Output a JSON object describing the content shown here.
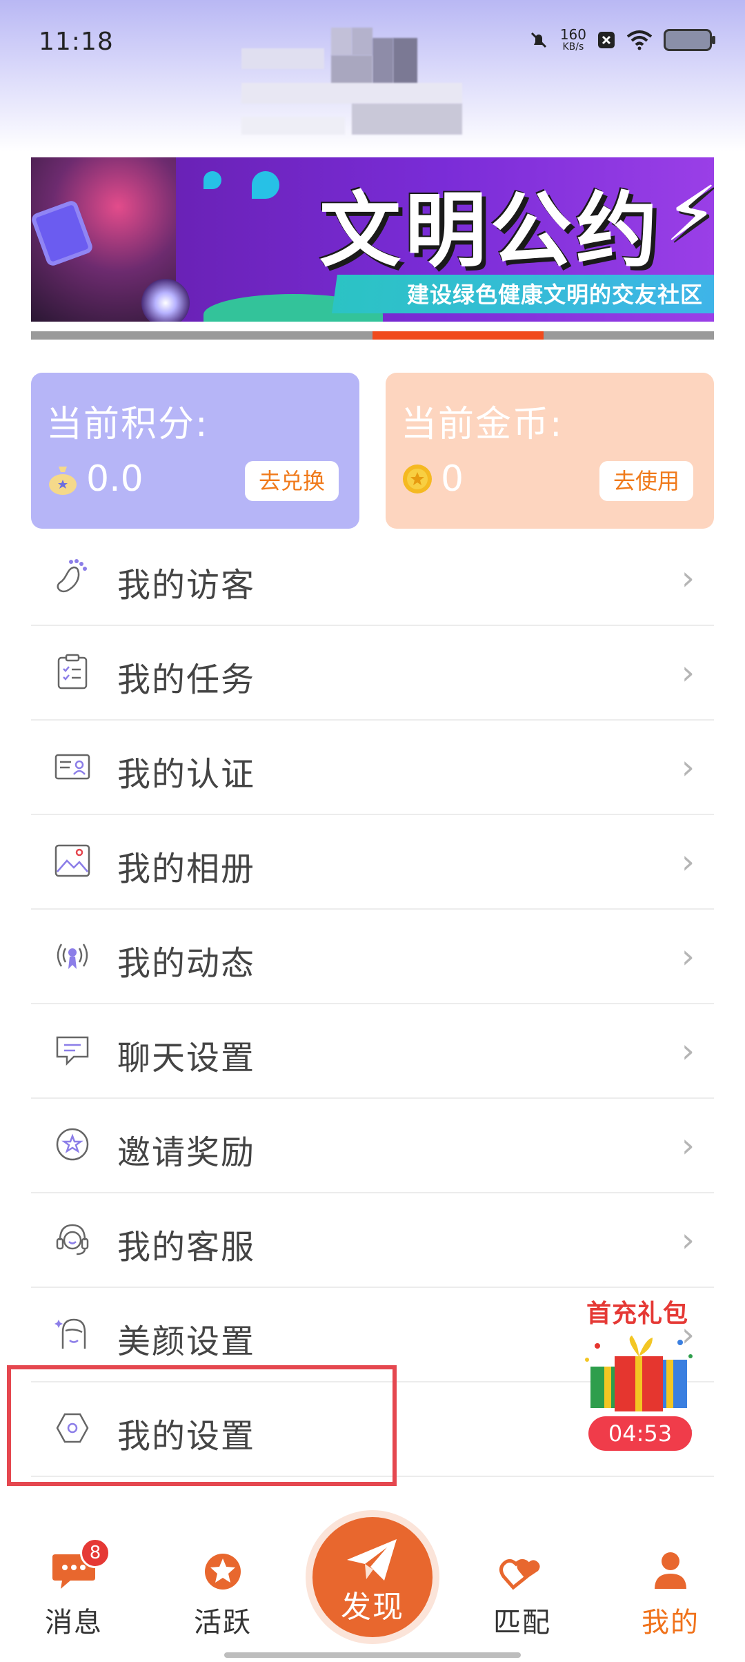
{
  "status_bar": {
    "time": "11:18",
    "speed_value": "160",
    "speed_unit": "KB/s"
  },
  "banner": {
    "title": "文明公约",
    "subtitle": "建设绿色健康文明的交友社区"
  },
  "cards": {
    "points": {
      "title": "当前积分:",
      "value": "0.0",
      "button": "去兑换",
      "icon": "money-bag-icon"
    },
    "gold": {
      "title": "当前金币:",
      "value": "0",
      "button": "去使用",
      "icon": "coin-icon"
    }
  },
  "menu": [
    {
      "label": "我的访客",
      "icon": "footprint-icon"
    },
    {
      "label": "我的任务",
      "icon": "clipboard-icon"
    },
    {
      "label": "我的认证",
      "icon": "id-card-icon"
    },
    {
      "label": "我的相册",
      "icon": "photo-icon"
    },
    {
      "label": "我的动态",
      "icon": "broadcast-icon"
    },
    {
      "label": "聊天设置",
      "icon": "chat-icon"
    },
    {
      "label": "邀请奖励",
      "icon": "star-badge-icon"
    },
    {
      "label": "我的客服",
      "icon": "headset-icon"
    },
    {
      "label": "美颜设置",
      "icon": "face-icon"
    },
    {
      "label": "我的设置",
      "icon": "settings-hexagon-icon"
    }
  ],
  "gift": {
    "title": "首充礼包",
    "timer": "04:53"
  },
  "bottom_nav": {
    "messages": {
      "label": "消息",
      "badge": "8"
    },
    "active": {
      "label": "活跃"
    },
    "discover": {
      "label": "发现"
    },
    "match": {
      "label": "匹配"
    },
    "mine": {
      "label": "我的"
    }
  },
  "colors": {
    "accent_orange": "#f0721b",
    "banner_indicator": "#f04a1c",
    "points_card": "#b6b5f7",
    "gold_card": "#fdd5bf",
    "highlight_red": "#e5474f"
  }
}
